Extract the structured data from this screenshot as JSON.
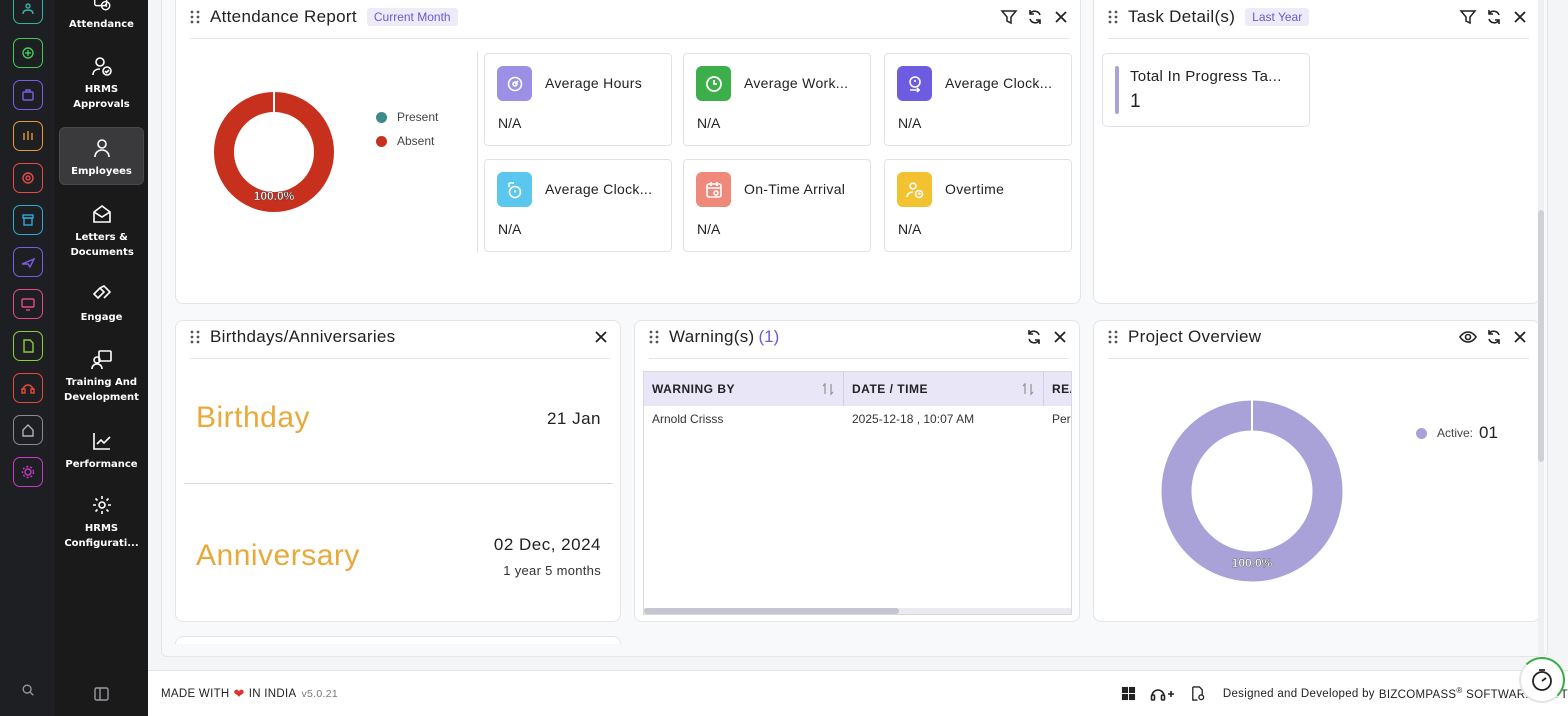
{
  "sidebar": {
    "items": [
      {
        "label": "Attendance",
        "icon": "clock-icon"
      },
      {
        "label": "HRMS Approvals",
        "icon": "user-check-icon"
      },
      {
        "label": "Employees",
        "icon": "user-icon"
      },
      {
        "label": "Letters & Documents",
        "icon": "mail-icon"
      },
      {
        "label": "Engage",
        "icon": "handshake-icon"
      },
      {
        "label": "Training And Development",
        "icon": "presentation-icon"
      },
      {
        "label": "Performance",
        "icon": "chart-line-icon"
      },
      {
        "label": "HRMS Configurati...",
        "icon": "gear-icon"
      }
    ],
    "active": "Employees"
  },
  "rail": {
    "colors": [
      "#2fb5a5",
      "#44c95a",
      "#7c5ce6",
      "#e89a2c",
      "#e84a4a",
      "#2fa9d6",
      "#7c5ce6",
      "#e44a8a",
      "#8acd3a",
      "#e84a3a",
      "#b0b0b8",
      "#c838c8"
    ]
  },
  "attendance": {
    "title": "Attendance Report",
    "tag": "Current Month",
    "legend": [
      {
        "label": "Present",
        "color": "#3d8a8a"
      },
      {
        "label": "Absent",
        "color": "#c8301e"
      }
    ],
    "donut_label": "100.0%",
    "absent_fraction": 1.0,
    "metrics": [
      {
        "label": "Average Hours",
        "value": "N/A",
        "icon": "clock-dial-icon",
        "color": "#9c8fe6"
      },
      {
        "label": "Average Work...",
        "value": "N/A",
        "icon": "clock-icon",
        "color": "#3cae4a"
      },
      {
        "label": "Average Clock...",
        "value": "N/A",
        "icon": "clock-out-icon",
        "color": "#6d5ce0"
      },
      {
        "label": "Average Clock...",
        "value": "N/A",
        "icon": "stopwatch-icon",
        "color": "#5bc6ee"
      },
      {
        "label": "On-Time Arrival",
        "value": "N/A",
        "icon": "calendar-icon",
        "color": "#ef8a7a"
      },
      {
        "label": "Overtime",
        "value": "N/A",
        "icon": "user-clock-icon",
        "color": "#f2c230"
      }
    ]
  },
  "tasks": {
    "title": "Task Detail(s)",
    "tag": "Last Year",
    "stat_label": "Total In Progress Ta...",
    "stat_value": "1"
  },
  "birthdays": {
    "title": "Birthdays/Anniversaries",
    "birthday_label": "Birthday",
    "birthday_date": "21 Jan",
    "anniversary_label": "Anniversary",
    "anniversary_date": "02 Dec, 2024",
    "anniversary_duration": "1 year 5 months"
  },
  "warnings": {
    "title": "Warning(s)",
    "count": "(1)",
    "columns": [
      "WARNING BY",
      "DATE / TIME",
      "REA"
    ],
    "rows": [
      {
        "by": "Arnold Crisss",
        "datetime": "2025-12-18 , 10:07 AM",
        "reason": "Per"
      }
    ]
  },
  "project": {
    "title": "Project Overview",
    "legend_label": "Active:",
    "legend_value": "01",
    "legend_color": "#a9a2d8",
    "donut_label": "100.0%",
    "active_fraction": 1.0
  },
  "footer": {
    "made_with": "MADE WITH",
    "in_india": "IN INDIA",
    "version": "v5.0.21",
    "designed_by": "Designed and Developed by",
    "company": "BIZCOMPASS",
    "reg": "®",
    "company_rest": "SOFTWARES PVT"
  }
}
